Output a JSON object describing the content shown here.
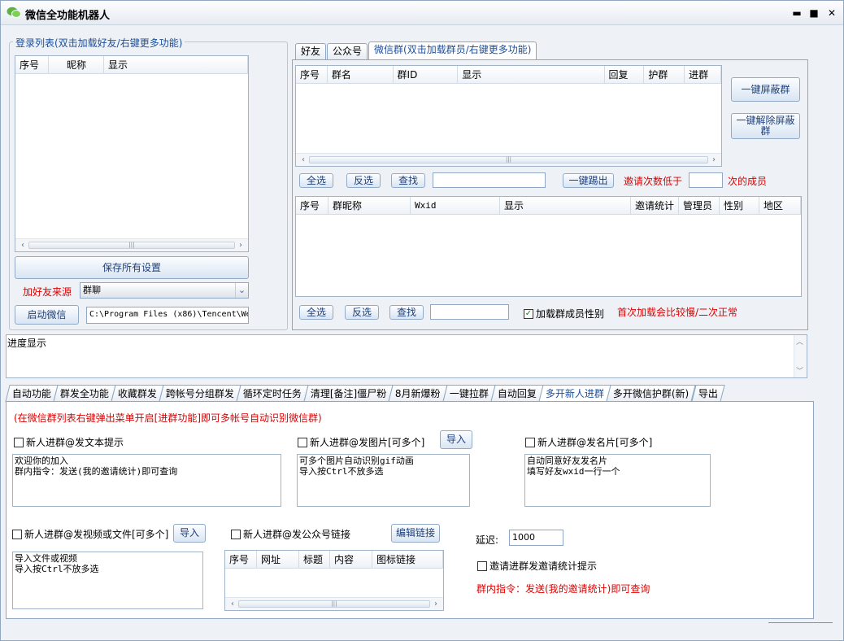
{
  "window": {
    "title": "微信全功能机器人",
    "controls": [
      "▬",
      "■",
      "✕"
    ]
  },
  "login": {
    "group_title": "登录列表(双击加载好友/右键更多功能)",
    "columns": [
      "序号",
      "昵称",
      "显示"
    ],
    "save_all": "保存所有设置",
    "source_label": "加好友来源",
    "source_value": "群聊",
    "start_wechat": "启动微信",
    "path_value": "C:\\Program Files (x86)\\Tencent\\We"
  },
  "top_tabs": [
    "好友",
    "公众号",
    "微信群(双击加载群员/右键更多功能)"
  ],
  "groups_grid": {
    "columns": [
      "序号",
      "群名",
      "群ID",
      "显示",
      "回复",
      "护群",
      "进群"
    ]
  },
  "side_buttons": {
    "block_all": "一键屏蔽群",
    "unblock_all": "一键解除屏蔽群"
  },
  "row1": {
    "select_all": "全选",
    "invert": "反选",
    "search": "查找",
    "search_value": "",
    "kick": "一键踢出",
    "invite_label_pre": "邀请次数低于",
    "invite_value": "",
    "invite_label_post": "次的成员"
  },
  "members_grid": {
    "columns": [
      "序号",
      "群昵称",
      "Wxid",
      "显示",
      "邀请统计",
      "管理员",
      "性别",
      "地区"
    ]
  },
  "row2": {
    "select_all": "全选",
    "invert": "反选",
    "search": "查找",
    "search_value": "",
    "load_gender": "加载群成员性别",
    "note": "首次加载会比较慢/二次正常"
  },
  "progress": {
    "label": "进度显示"
  },
  "bottom_tabs": [
    "自动功能",
    "群发全功能",
    "收藏群发",
    "跨帐号分组群发",
    "循环定时任务",
    "清理[备注]僵尸粉",
    "8月新爆粉",
    "一键拉群",
    "自动回复",
    "多开新人进群",
    "多开微信护群(新)",
    "导出"
  ],
  "newjoin": {
    "hint": "(在微信群列表右键弹出菜单开启[进群功能]即可多帐号自动识别微信群)",
    "text_tip": "新人进群@发文本提示",
    "text_tip_content": "欢迎你的加入\n群内指令：发送(我的邀请统计)即可查询",
    "send_image": "新人进群@发图片[可多个]",
    "import_image": "导入",
    "image_content": "可多个图片自动识别gif动画\n导入按Ctrl不放多选",
    "send_card": "新人进群@发名片[可多个]",
    "card_content": "自动同意好友发名片\n填写好友wxid一行一个",
    "send_video": "新人进群@发视频或文件[可多个]",
    "import_video": "导入",
    "video_content": "导入文件或视频\n导入按Ctrl不放多选",
    "send_mp": "新人进群@发公众号链接",
    "edit_link": "编辑链接",
    "link_columns": [
      "序号",
      "网址",
      "标题",
      "内容",
      "图标链接"
    ],
    "delay_label": "延迟:",
    "delay_value": "1000",
    "invite_stats": "邀请进群发邀请统计提示",
    "command_hint": "群内指令：发送(我的邀请统计)即可查询"
  }
}
